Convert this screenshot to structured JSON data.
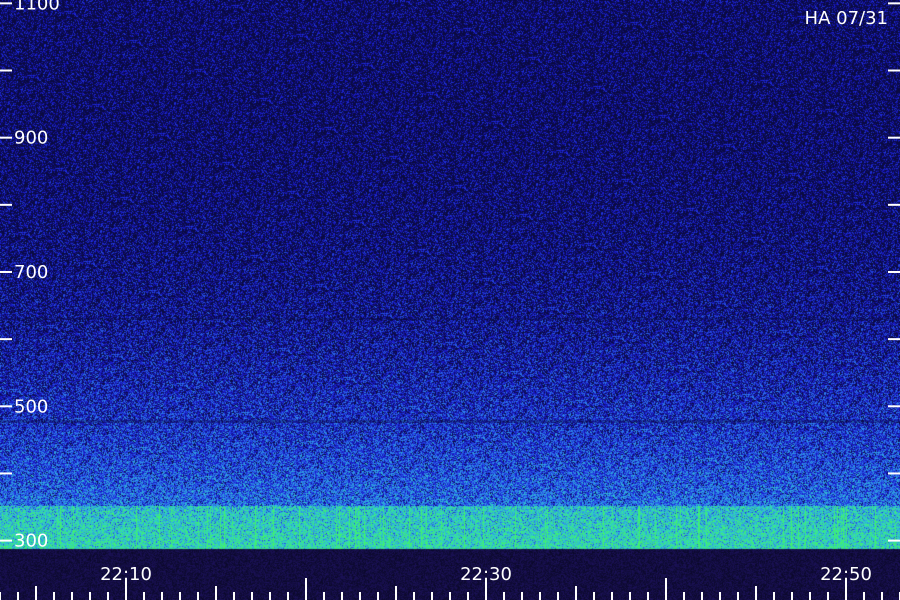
{
  "chart_data": {
    "type": "heatmap",
    "title": "HA 07/31",
    "xlabel": "",
    "ylabel": "",
    "x": {
      "range": [
        "22:03",
        "22:53"
      ],
      "ticks": [
        {
          "value": "22:10",
          "label": "22:10"
        },
        {
          "value": "22:30",
          "label": "22:30"
        },
        {
          "value": "22:50",
          "label": "22:50"
        }
      ]
    },
    "y": {
      "range": [
        289,
        1105
      ],
      "ticks": [
        {
          "value": 300,
          "label": "300"
        },
        {
          "value": 500,
          "label": "500"
        },
        {
          "value": 700,
          "label": "700"
        },
        {
          "value": 900,
          "label": "900"
        },
        {
          "value": 1100,
          "label": "1100"
        }
      ]
    },
    "colorscale": [
      "#0a0a40",
      "#1a1ad0",
      "#2f7ff0",
      "#2fd0c8",
      "#40f070"
    ],
    "grid": false,
    "legend": "none"
  }
}
